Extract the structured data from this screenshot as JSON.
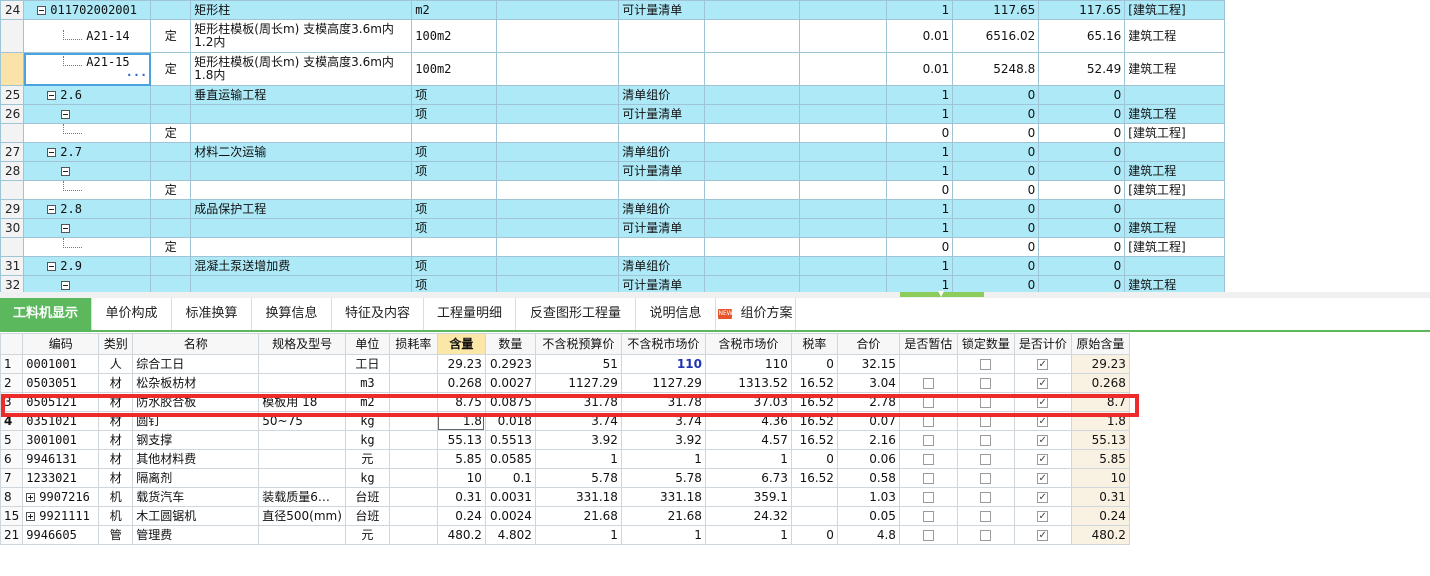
{
  "top_rows": [
    {
      "type": "blue",
      "rn": "24",
      "toggle": "minus",
      "code": "011702002001",
      "kind": "",
      "name": "矩形柱",
      "unit": "m2",
      "c1": "",
      "category": "可计量清单",
      "c2": "",
      "c3": "",
      "qty": "1",
      "price": "117.65",
      "total": "117.65",
      "spec": "[建筑工程]"
    },
    {
      "type": "white tall",
      "rn": "",
      "branch": true,
      "code": "A21-14",
      "kind": "定",
      "name": "矩形柱模板(周长m) 支模高度3.6m内 1.2内",
      "unit": "100m2",
      "c1": "",
      "category": "",
      "c2": "",
      "c3": "",
      "qty": "0.01",
      "price": "6516.02",
      "total": "65.16",
      "spec": "建筑工程"
    },
    {
      "type": "white tall",
      "rn": "",
      "sel": true,
      "branch": true,
      "focus": true,
      "code": "A21-15",
      "kind": "定",
      "name": "矩形柱模板(周长m) 支模高度3.6m内 1.8内",
      "unit": "100m2",
      "c1": "",
      "category": "",
      "c2": "",
      "c3": "",
      "qty": "0.01",
      "price": "5248.8",
      "total": "52.49",
      "spec": "建筑工程"
    },
    {
      "type": "blue",
      "rn": "25",
      "toggle": "minus",
      "indent": 1,
      "code": "2.6",
      "kind": "",
      "name": "垂直运输工程",
      "unit": "项",
      "c1": "",
      "category": "清单组价",
      "c2": "",
      "c3": "",
      "qty": "1",
      "price": "0",
      "total": "0",
      "spec": ""
    },
    {
      "type": "blue",
      "rn": "26",
      "toggle": "minus",
      "indent": 2,
      "code": "",
      "kind": "",
      "name": "",
      "unit": "项",
      "c1": "",
      "category": "可计量清单",
      "c2": "",
      "c3": "",
      "qty": "1",
      "price": "0",
      "total": "0",
      "spec": "建筑工程"
    },
    {
      "type": "white",
      "rn": "",
      "branch": true,
      "code": "",
      "kind": "定",
      "name": "",
      "unit": "",
      "c1": "",
      "category": "",
      "c2": "",
      "c3": "",
      "qty": "0",
      "price": "0",
      "total": "0",
      "spec": "[建筑工程]"
    },
    {
      "type": "blue",
      "rn": "27",
      "toggle": "minus",
      "indent": 1,
      "code": "2.7",
      "kind": "",
      "name": "材料二次运输",
      "unit": "项",
      "c1": "",
      "category": "清单组价",
      "c2": "",
      "c3": "",
      "qty": "1",
      "price": "0",
      "total": "0",
      "spec": ""
    },
    {
      "type": "blue",
      "rn": "28",
      "toggle": "minus",
      "indent": 2,
      "code": "",
      "kind": "",
      "name": "",
      "unit": "项",
      "c1": "",
      "category": "可计量清单",
      "c2": "",
      "c3": "",
      "qty": "1",
      "price": "0",
      "total": "0",
      "spec": "建筑工程"
    },
    {
      "type": "white",
      "rn": "",
      "branch": true,
      "code": "",
      "kind": "定",
      "name": "",
      "unit": "",
      "c1": "",
      "category": "",
      "c2": "",
      "c3": "",
      "qty": "0",
      "price": "0",
      "total": "0",
      "spec": "[建筑工程]"
    },
    {
      "type": "blue",
      "rn": "29",
      "toggle": "minus",
      "indent": 1,
      "code": "2.8",
      "kind": "",
      "name": "成品保护工程",
      "unit": "项",
      "c1": "",
      "category": "清单组价",
      "c2": "",
      "c3": "",
      "qty": "1",
      "price": "0",
      "total": "0",
      "spec": ""
    },
    {
      "type": "blue",
      "rn": "30",
      "toggle": "minus",
      "indent": 2,
      "code": "",
      "kind": "",
      "name": "",
      "unit": "项",
      "c1": "",
      "category": "可计量清单",
      "c2": "",
      "c3": "",
      "qty": "1",
      "price": "0",
      "total": "0",
      "spec": "建筑工程"
    },
    {
      "type": "white",
      "rn": "",
      "branch": true,
      "code": "",
      "kind": "定",
      "name": "",
      "unit": "",
      "c1": "",
      "category": "",
      "c2": "",
      "c3": "",
      "qty": "0",
      "price": "0",
      "total": "0",
      "spec": "[建筑工程]"
    },
    {
      "type": "blue",
      "rn": "31",
      "toggle": "minus",
      "indent": 1,
      "code": "2.9",
      "kind": "",
      "name": "混凝土泵送增加费",
      "unit": "项",
      "c1": "",
      "category": "清单组价",
      "c2": "",
      "c3": "",
      "qty": "1",
      "price": "0",
      "total": "0",
      "spec": ""
    },
    {
      "type": "blue",
      "rn": "32",
      "toggle": "minus",
      "indent": 2,
      "code": "",
      "kind": "",
      "name": "",
      "unit": "项",
      "c1": "",
      "category": "可计量清单",
      "c2": "",
      "c3": "",
      "qty": "1",
      "price": "0",
      "total": "0",
      "spec": "建筑工程"
    }
  ],
  "tabs": [
    {
      "label": "工料机显示",
      "active": true
    },
    {
      "label": "单价构成"
    },
    {
      "label": "标准换算"
    },
    {
      "label": "换算信息"
    },
    {
      "label": "特征及内容"
    },
    {
      "label": "工程量明细"
    },
    {
      "label": "反查图形工程量"
    },
    {
      "label": "说明信息"
    },
    {
      "label": "组价方案",
      "badge": "NEW"
    }
  ],
  "bottom_headers": [
    "编码",
    "类别",
    "名称",
    "规格及型号",
    "单位",
    "损耗率",
    "含量",
    "数量",
    "不含税预算价",
    "不含税市场价",
    "含税市场价",
    "税率",
    "合价",
    "是否暂估",
    "锁定数量",
    "是否计价",
    "原始含量"
  ],
  "bottom_rows": [
    {
      "rn": "1",
      "code": "0001001",
      "kind": "人",
      "name": "综合工日",
      "spec": "",
      "unit": "工日",
      "loss": "",
      "content": "29.23",
      "qty": "0.2923",
      "budget": "51",
      "market": "110",
      "market_blue": true,
      "tax_market": "110",
      "rate": "0",
      "total": "32.15",
      "est": null,
      "lock": false,
      "priced": true,
      "orig": "29.23"
    },
    {
      "rn": "2",
      "code": "0503051",
      "kind": "材",
      "name": "松杂板枋材",
      "spec": "",
      "unit": "m3",
      "loss": "",
      "content": "0.268",
      "qty": "0.0027",
      "budget": "1127.29",
      "market": "1127.29",
      "tax_market": "1313.52",
      "rate": "16.52",
      "total": "3.04",
      "est": false,
      "lock": false,
      "priced": true,
      "orig": "0.268"
    },
    {
      "rn": "3",
      "code": "0505121",
      "kind": "材",
      "name": "防水胶合板",
      "spec": "模板用 18",
      "unit": "m2",
      "loss": "",
      "content": "8.75",
      "qty": "0.0875",
      "budget": "31.78",
      "market": "31.78",
      "tax_market": "37.03",
      "rate": "16.52",
      "total": "2.78",
      "est": false,
      "lock": false,
      "priced": true,
      "orig": "8.7"
    },
    {
      "rn": "4",
      "cur": true,
      "edit": true,
      "code": "0351021",
      "kind": "材",
      "name": "圆钉",
      "spec": "50~75",
      "unit": "kg",
      "loss": "",
      "content": "1.8",
      "qty": "0.018",
      "budget": "3.74",
      "market": "3.74",
      "tax_market": "4.36",
      "rate": "16.52",
      "total": "0.07",
      "est": false,
      "lock": false,
      "priced": true,
      "orig": "1.8"
    },
    {
      "rn": "5",
      "code": "3001001",
      "kind": "材",
      "name": "钢支撑",
      "spec": "",
      "unit": "kg",
      "loss": "",
      "content": "55.13",
      "qty": "0.5513",
      "budget": "3.92",
      "market": "3.92",
      "tax_market": "4.57",
      "rate": "16.52",
      "total": "2.16",
      "est": false,
      "lock": false,
      "priced": true,
      "orig": "55.13"
    },
    {
      "rn": "6",
      "code": "9946131",
      "kind": "材",
      "name": "其他材料费",
      "spec": "",
      "unit": "元",
      "loss": "",
      "content": "5.85",
      "qty": "0.0585",
      "budget": "1",
      "market": "1",
      "tax_market": "1",
      "rate": "0",
      "total": "0.06",
      "est": false,
      "lock": false,
      "priced": true,
      "orig": "5.85"
    },
    {
      "rn": "7",
      "code": "1233021",
      "kind": "材",
      "name": "隔离剂",
      "spec": "",
      "unit": "kg",
      "loss": "",
      "content": "10",
      "qty": "0.1",
      "budget": "5.78",
      "market": "5.78",
      "tax_market": "6.73",
      "rate": "16.52",
      "total": "0.58",
      "est": false,
      "lock": false,
      "priced": true,
      "orig": "10"
    },
    {
      "rn": "8",
      "plus": true,
      "code": "9907216",
      "kind": "机",
      "name": "载货汽车",
      "spec": "装载质量6…",
      "unit": "台班",
      "loss": "",
      "content": "0.31",
      "qty": "0.0031",
      "budget": "331.18",
      "market": "331.18",
      "tax_market": "359.1",
      "rate": "",
      "total": "1.03",
      "est": false,
      "lock": false,
      "priced": true,
      "orig": "0.31"
    },
    {
      "rn": "15",
      "plus": true,
      "code": "9921111",
      "kind": "机",
      "name": "木工圆锯机",
      "spec": "直径500(mm)",
      "unit": "台班",
      "loss": "",
      "content": "0.24",
      "qty": "0.0024",
      "budget": "21.68",
      "market": "21.68",
      "tax_market": "24.32",
      "rate": "",
      "total": "0.05",
      "est": false,
      "lock": false,
      "priced": true,
      "orig": "0.24"
    },
    {
      "rn": "21",
      "code": "9946605",
      "kind": "管",
      "name": "管理费",
      "spec": "",
      "unit": "元",
      "loss": "",
      "content": "480.2",
      "qty": "4.802",
      "budget": "1",
      "market": "1",
      "tax_market": "1",
      "rate": "0",
      "total": "4.8",
      "est": false,
      "lock": false,
      "priced": true,
      "orig": "480.2"
    }
  ]
}
